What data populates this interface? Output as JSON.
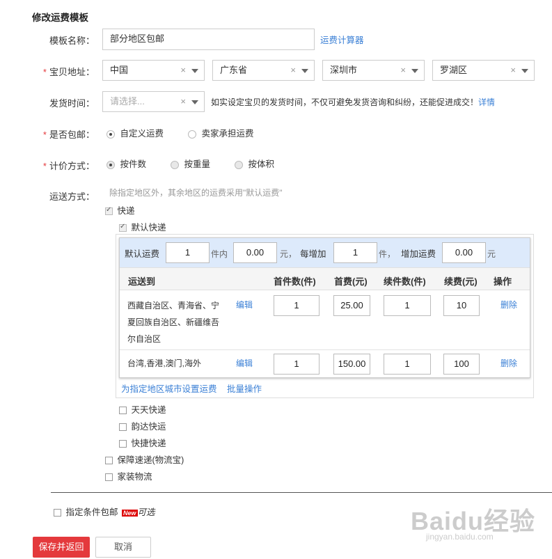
{
  "title": "修改运费模板",
  "fields": {
    "template_name": {
      "label": "模板名称：",
      "value": "部分地区包邮",
      "calc_link": "运费计算器"
    },
    "address": {
      "label": "宝贝地址：",
      "country": "中国",
      "province": "广东省",
      "city": "深圳市",
      "district": "罗湖区",
      "clear": "×"
    },
    "ship_time": {
      "label": "发货时间：",
      "placeholder": "请选择...",
      "hint": "如实设定宝贝的发货时间，不仅可避免发货咨询和纠纷，还能促进成交！",
      "detail_link": "详情",
      "clear": "×"
    },
    "free_shipping": {
      "label": "是否包邮：",
      "opt1": "自定义运费",
      "opt2": "卖家承担运费"
    },
    "pricing": {
      "label": "计价方式：",
      "opt1": "按件数",
      "opt2": "按重量",
      "opt3": "按体积"
    },
    "delivery": {
      "label": "运送方式：",
      "hint": "除指定地区外，其余地区的运费采用\"默认运费\""
    },
    "req_mark": "*"
  },
  "express": {
    "label": "快递",
    "default_label": "默认快递",
    "default_row": {
      "t1": "默认运费",
      "first_qty": "1",
      "t2": "件内",
      "first_fee": "0.00",
      "t3": "元，",
      "t4": "每增加",
      "add_qty": "1",
      "t5": "件，",
      "t6": "增加运费",
      "add_fee": "0.00",
      "t7": "元"
    },
    "headers": {
      "dest": "运送到",
      "first_qty": "首件数(件)",
      "first_fee": "首费(元)",
      "add_qty": "续件数(件)",
      "add_fee": "续费(元)",
      "op": "操作"
    },
    "rows": [
      {
        "dest1": "西藏自治区、青海省、宁",
        "dest2": "夏回族自治区、新疆维吾",
        "dest3": "尔自治区",
        "edit": "编辑",
        "first_qty": "1",
        "first_fee": "25.00",
        "add_qty": "1",
        "add_fee": "10",
        "delete": "删除"
      },
      {
        "dest1": "台湾,香港,澳门,海外",
        "edit": "编辑",
        "first_qty": "1",
        "first_fee": "150.00",
        "add_qty": "1",
        "add_fee": "100",
        "delete": "删除"
      }
    ],
    "set_link": "为指定地区城市设置运费",
    "batch_link": "批量操作"
  },
  "other_express": [
    "天天快递",
    "韵达快运",
    "快捷快递"
  ],
  "other_methods": [
    "保障速递(物流宝)",
    "家装物流"
  ],
  "conditional": {
    "label": "指定条件包邮",
    "badge": "New",
    "optional": "可选"
  },
  "buttons": {
    "save": "保存并返回",
    "cancel": "取消"
  },
  "watermark": {
    "brand": "Baidu经验",
    "url": "jingyan.baidu.com"
  },
  "colors": {
    "accent": "#e4393c",
    "link": "#3b80d6",
    "table_head": "#ddeafb"
  }
}
